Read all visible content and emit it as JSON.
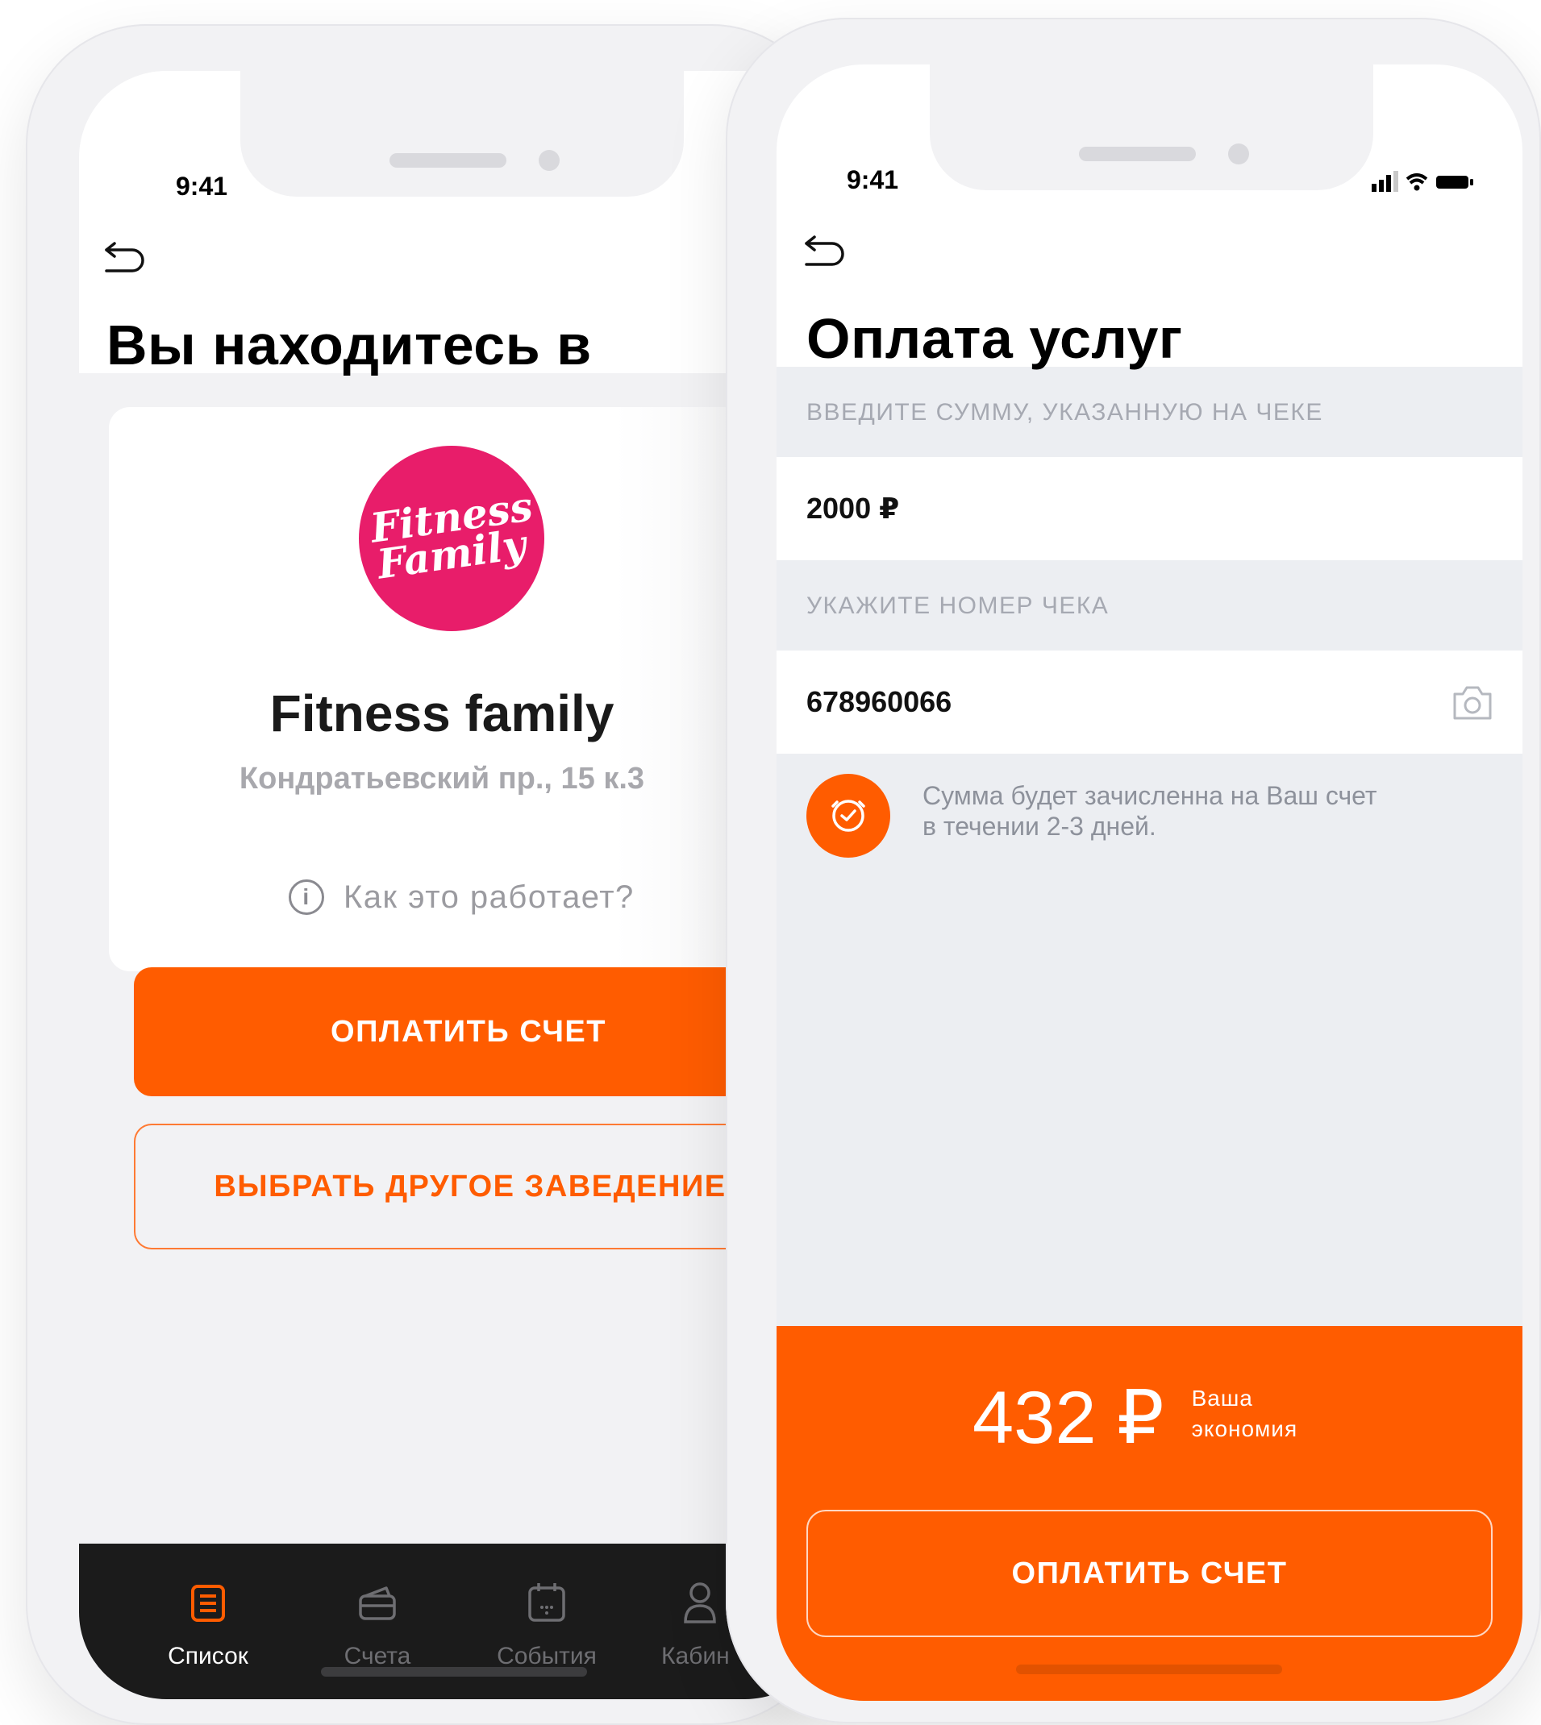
{
  "screen_list": {
    "status_time": "9:41",
    "title": "Вы находитесь в",
    "venue": {
      "logo_line1": "Fitness",
      "logo_line2": "Family",
      "name": "Fitness family",
      "address": "Кондратьевский пр., 15 к.3"
    },
    "how_it_works": "Как это работает?",
    "info_icon_glyph": "i",
    "pay_button": "ОПЛАТИТЬ СЧЕТ",
    "choose_other_button": "ВЫБРАТЬ ДРУГОЕ ЗАВЕДЕНИЕ",
    "tabs": [
      {
        "label": "Список",
        "icon": "list-icon",
        "active": true
      },
      {
        "label": "Счета",
        "icon": "wallet-icon",
        "active": false
      },
      {
        "label": "События",
        "icon": "calendar-icon",
        "active": false
      },
      {
        "label": "Кабин",
        "icon": "user-icon",
        "active": false
      }
    ]
  },
  "screen_payment": {
    "status_time": "9:41",
    "title": "Оплата услуг",
    "amount_label": "ВВЕДИТЕ СУММУ, УКАЗАННУЮ НА ЧЕКЕ",
    "amount_value": "2000 ₽",
    "receipt_label": "УКАЖИТЕ НОМЕР ЧЕКА",
    "receipt_value": "678960066",
    "notice_line1": "Сумма будет зачисленна на Ваш счет",
    "notice_line2": "в течении 2-3 дней.",
    "savings_amount": "432 ₽",
    "savings_label_line1": "Ваша",
    "savings_label_line2": "экономия",
    "pay_button": "ОПЛАТИТЬ СЧЕТ"
  },
  "colors": {
    "accent": "#ff5c00",
    "logo": "#e81d6a",
    "tabbar": "#1b1b1b"
  }
}
